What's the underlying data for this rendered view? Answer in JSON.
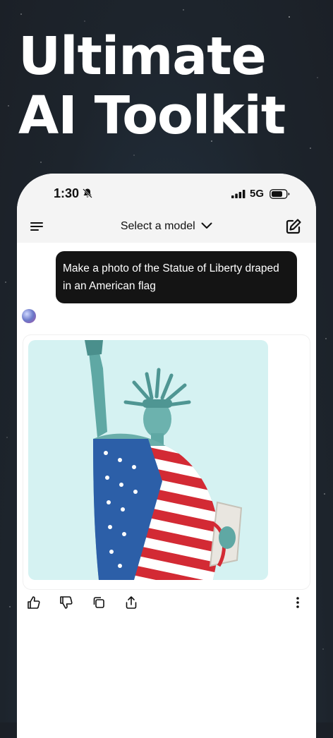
{
  "headline": "Ultimate AI Toolkit",
  "status_bar": {
    "time": "1:30",
    "network": "5G"
  },
  "app_bar": {
    "model_select_label": "Select a model"
  },
  "chat": {
    "user_message": "Make a photo of the Statue of Liberty draped in an American flag"
  },
  "icons": [
    "menu-icon",
    "chevron-down-icon",
    "compose-icon",
    "bell-off-icon",
    "signal-icon",
    "battery-icon",
    "thumbs-up-icon",
    "thumbs-down-icon",
    "copy-icon",
    "share-icon",
    "more-icon"
  ]
}
